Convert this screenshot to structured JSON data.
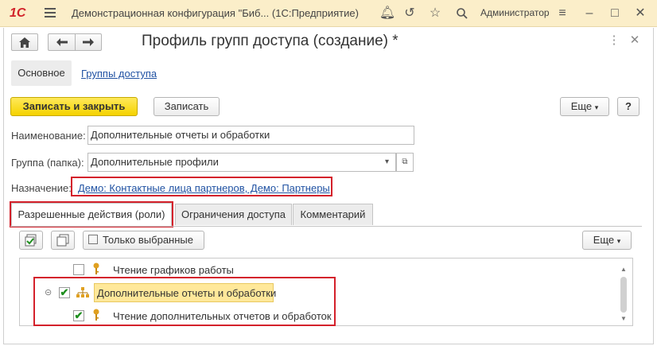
{
  "app": {
    "logo": "1С",
    "title": "Демонстрационная конфигурация \"Биб...  (1С:Предприятие)",
    "user": "Администратор"
  },
  "form": {
    "title": "Профиль групп доступа (создание) *"
  },
  "sections": {
    "main": "Основное",
    "access_groups": "Группы доступа"
  },
  "toolbar": {
    "save_close": "Записать и закрыть",
    "save": "Записать",
    "more": "Еще",
    "help": "?"
  },
  "fields": {
    "name_label": "Наименование:",
    "name_value": "Дополнительные отчеты и обработки",
    "group_label": "Группа (папка):",
    "group_value": "Дополнительные профили",
    "purpose_label": "Назначение:",
    "purpose_value": "Демо: Контактные лица партнеров, Демо: Партнеры"
  },
  "tabs": [
    {
      "label": "Разрешенные действия (роли)",
      "active": true
    },
    {
      "label": "Ограничения доступа",
      "active": false
    },
    {
      "label": "Комментарий",
      "active": false
    }
  ],
  "roles_toolbar": {
    "only_selected": "Только выбранные",
    "more": "Еще"
  },
  "roles": [
    {
      "label": "Чтение графиков работы",
      "checked": false,
      "icon": "key-icon"
    },
    {
      "label": "Дополнительные отчеты и обработки",
      "checked": true,
      "icon": "hierarchy-icon",
      "expanded": true,
      "selected": true
    },
    {
      "label": "Чтение дополнительных отчетов и обработок",
      "checked": true,
      "icon": "key-icon"
    }
  ],
  "colors": {
    "titlebar_bg": "#fbeec9",
    "primary_button": "#f5d200",
    "link": "#2152a3",
    "highlight_box": "#d4212b",
    "selected_row": "#ffe89a"
  }
}
